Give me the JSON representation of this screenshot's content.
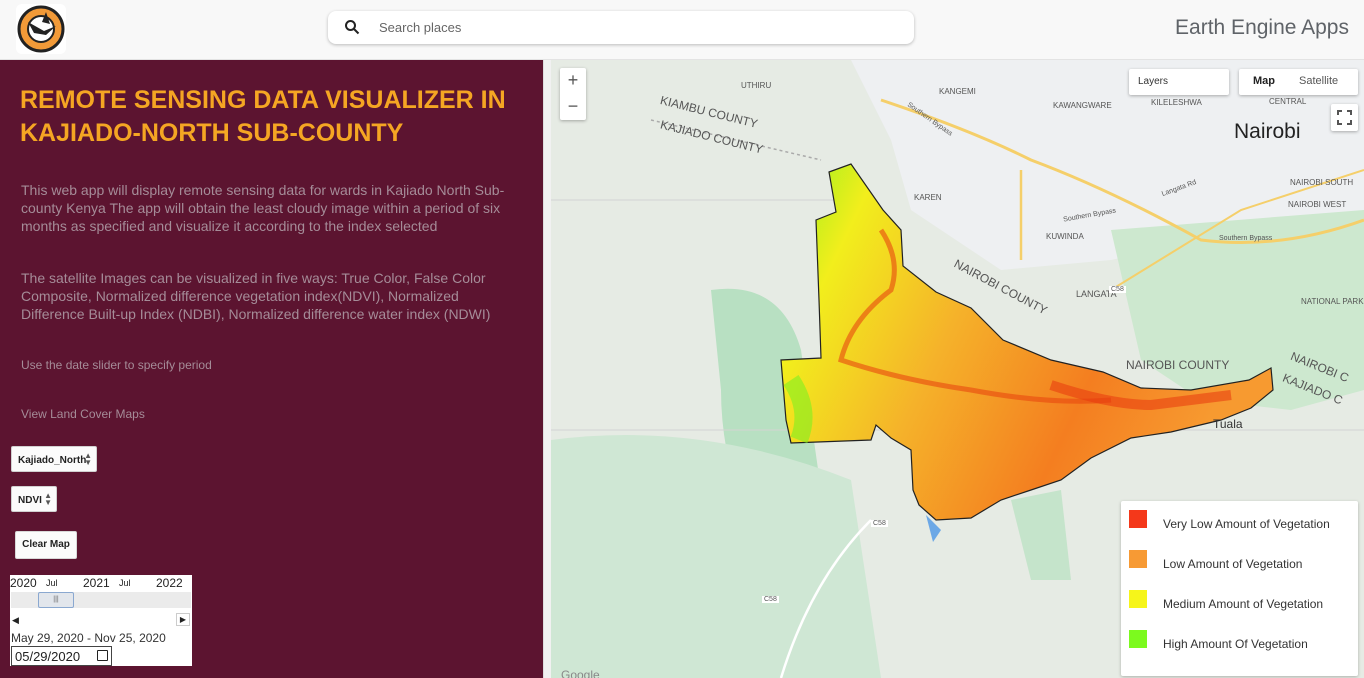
{
  "header": {
    "search_placeholder": "Search places",
    "app_title": "Earth Engine Apps"
  },
  "sidebar": {
    "title": "REMOTE SENSING DATA VISUALIZER IN KAJIADO-NORTH SUB-COUNTY",
    "description": "This web app will display remote sensing data for wards in Kajiado North Sub-county Kenya The app will obtain the least cloudy image within a period of six months as specified and visualize it according to the index selected",
    "visualization_info": "The satellite Images can be visualized in five ways: True Color, False Color Composite, Normalized difference vegetation index(NDVI), Normalized Difference Built-up Index (NDBI), Normalized difference water index (NDWI)",
    "slider_hint": "Use the date slider to specify period",
    "land_cover_link": "View Land Cover Maps",
    "region_select": "Kajiado_North",
    "index_select": "NDVI",
    "clear_button": "Clear Map",
    "slider": {
      "year_2020": "2020",
      "jul_1": "Jul",
      "year_2021": "2021",
      "jul_2": "Jul",
      "year_2022": "2022",
      "range_text": "May 29, 2020 - Nov 25, 2020",
      "date_value": "05/29/2020"
    }
  },
  "map": {
    "zoom_in": "+",
    "zoom_out": "−",
    "layers_label": "Layers",
    "map_type_map": "Map",
    "map_type_satellite": "Satellite",
    "labels": {
      "kiambu": "KIAMBU COUNTY",
      "kajiado_top": "KAJIADO COUNTY",
      "nairobi_county_mid": "NAIROBI COUNTY",
      "nairobi_county_right": "NAIROBI COUNTY",
      "nairobi_county_edge": "NAIROBI C",
      "kajiado_edge": "KAJIADO C",
      "nairobi": "Nairobi",
      "uthiru": "UTHIRU",
      "kangemi": "KANGEMI",
      "kawangware": "KAWANGWARE",
      "kileleshwa": "KILELESHWA",
      "nairobi_central": "NAIROBI CENTRAL",
      "karen": "KAREN",
      "kuwinda": "KUWINDA",
      "langata": "LANGATA",
      "nairobi_south": "NAIROBI SOUTH",
      "nairobi_west": "NAIROBI WEST",
      "national_park": "NATIONAL PARK",
      "tuala": "Tuala",
      "southern_bypass_1": "Southern Bypass",
      "southern_bypass_2": "Southern Bypass",
      "southern_bypass_3": "Southern Bypass",
      "langata_rd": "Langata Rd",
      "c58_1": "C58",
      "c58_2": "C58",
      "c58_3": "C58",
      "google": "Google"
    }
  },
  "legend": [
    {
      "label": "Very Low Amount of Vegetation",
      "color": "#f4381a"
    },
    {
      "label": "Low Amount of Vegetation",
      "color": "#f79a34"
    },
    {
      "label": "Medium Amount of Vegetation",
      "color": "#f6f51a"
    },
    {
      "label": "High Amount Of Vegetation",
      "color": "#7cfa1e"
    }
  ]
}
